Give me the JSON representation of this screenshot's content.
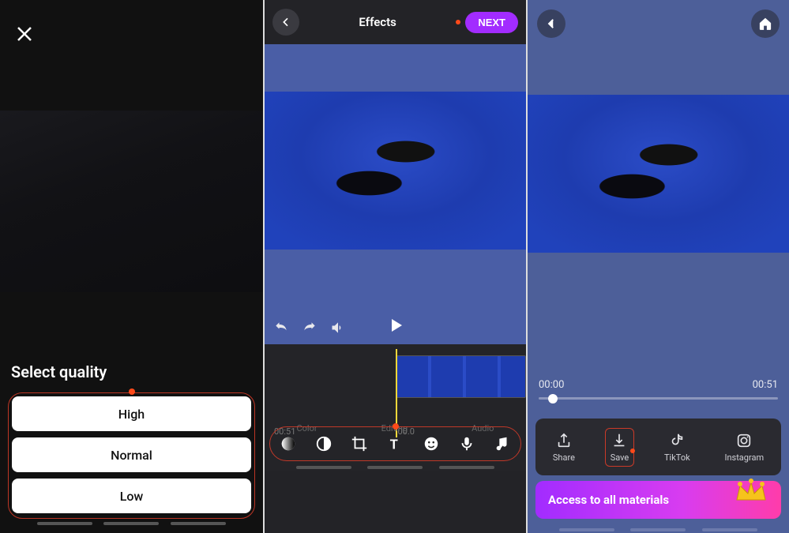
{
  "panel1": {
    "title": "Select quality",
    "options": [
      "High",
      "Normal",
      "Low"
    ]
  },
  "panel2": {
    "header_title": "Effects",
    "next_label": "NEXT",
    "timeline": {
      "left_time": "00:51",
      "center_time": "00.0"
    },
    "categories": [
      "Color",
      "Editing",
      "Audio"
    ],
    "tools": [
      "filter",
      "contrast",
      "crop",
      "text",
      "emoji",
      "mic",
      "music"
    ]
  },
  "panel3": {
    "time_current": "00:00",
    "time_total": "00:51",
    "actions": {
      "share": "Share",
      "save": "Save",
      "tiktok": "TikTok",
      "instagram": "Instagram"
    },
    "banner_text": "Access to all materials"
  }
}
